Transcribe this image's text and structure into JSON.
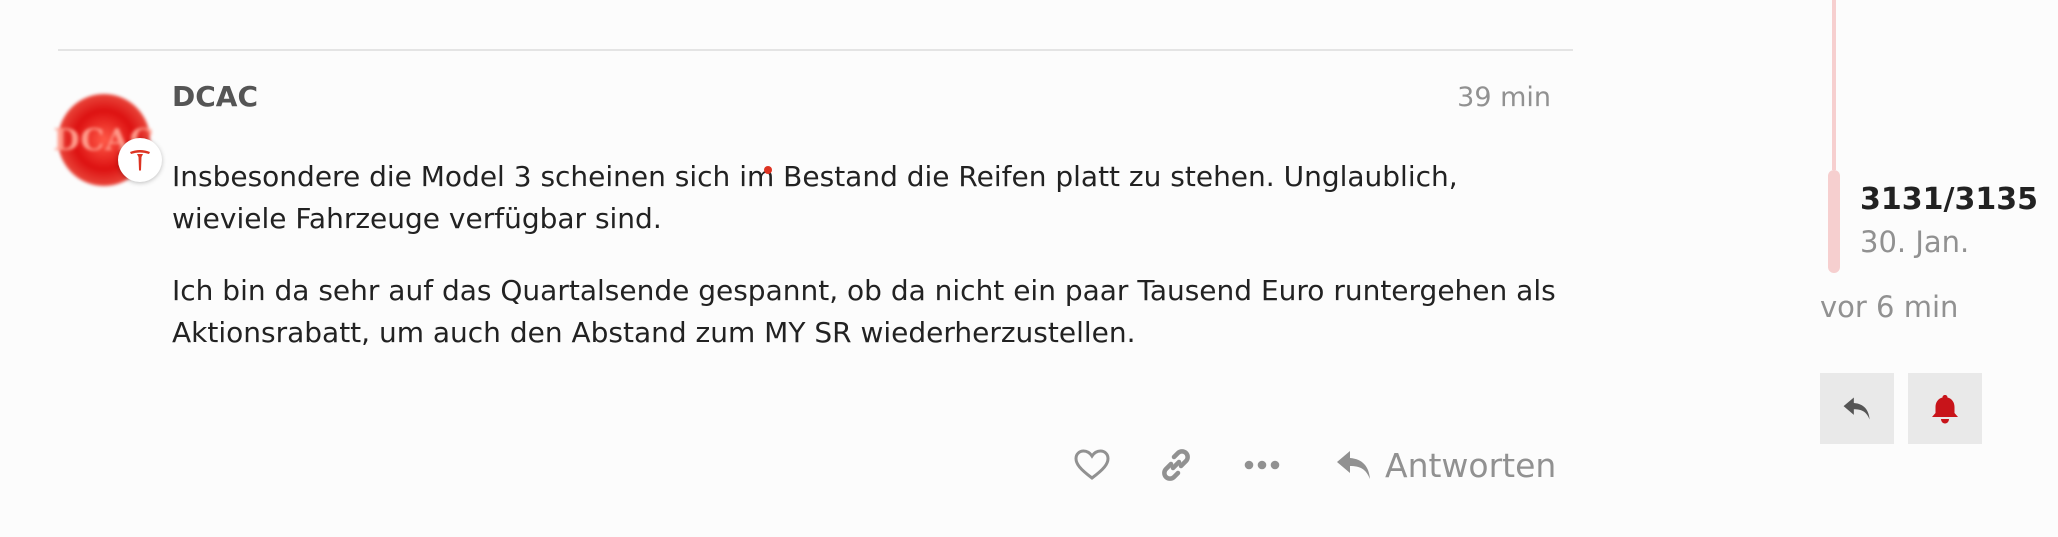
{
  "post": {
    "username": "DCAC",
    "time": "39 min",
    "avatar_text": "DCAC",
    "paragraphs": {
      "p1_before": "Insbesondere die Model 3 scheinen sich im",
      "p1_after": " Bestand die Reifen platt zu stehen. Unglaublich, wieviele Fahrzeuge verfügbar sind.",
      "p2": "Ich bin da sehr auf das Quartalsende gespannt, ob da nicht ein paar Tausend Euro runtergehen als Aktionsrabatt, um auch den Abstand zum MY SR wiederherzustellen."
    }
  },
  "actions": {
    "like_icon": "heart-icon",
    "link_icon": "link-icon",
    "more_icon": "ellipsis-icon",
    "reply_icon": "reply-icon",
    "reply_label": "Antworten"
  },
  "timeline": {
    "progress": "3131/3135",
    "date": "30. Jan.",
    "last_activity": "vor 6 min"
  },
  "colors": {
    "accent": "#d61f1f",
    "muted": "#919191",
    "track": "#f6cfcf"
  }
}
